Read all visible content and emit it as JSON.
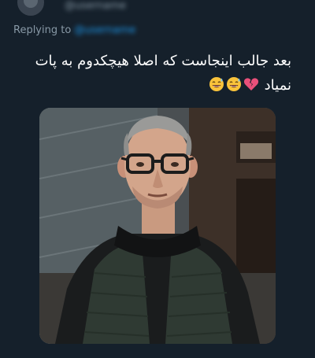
{
  "header": {
    "handle": "@username"
  },
  "reply": {
    "prefix": "Replying to",
    "handle": "@username"
  },
  "tweet": {
    "line1": "بعد جالب اینجاست که اصلا هیچکدوم به پات",
    "line2": "نمیاد",
    "emojis": [
      "broken-heart-emoji",
      "grinning-sweat-emoji",
      "grinning-sweat-emoji"
    ]
  },
  "media": {
    "alt": "photo"
  }
}
